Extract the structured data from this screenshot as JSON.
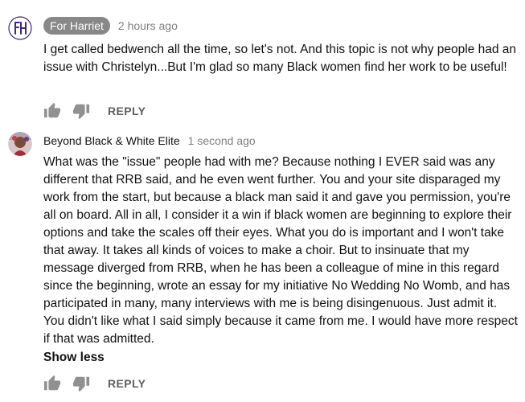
{
  "comments": [
    {
      "author": "For Harriet",
      "author_is_badge": true,
      "timestamp": "2 hours ago",
      "text": "I get called bedwench all the time, so let's not. And this topic is not why people had an issue with Christelyn...But I'm glad so many Black women find her work to be useful!",
      "like_icon": "thumbs-up-icon",
      "dislike_icon": "thumbs-down-icon",
      "reply_label": "REPLY",
      "avatar_icon": "FH monogram"
    },
    {
      "author": "Beyond Black & White Elite",
      "timestamp": "1 second ago",
      "text": "What was the \"issue\" people had with me? Because nothing I EVER said was any different that RRB said, and he even went further. You and your site disparaged my work from the start, but because a black man said it and gave you permission, you're all on board. All in all, I consider it a win if black women are beginning to explore their options and take the scales off their eyes. What you do is important and I won't take that away. It takes all kinds of voices to make a choir. But to insinuate that my message diverged from RRB, when he has been a colleague of mine in this regard since the beginning, wrote an essay for my initiative No Wedding No Womb, and has participated in many, many interviews with me is being disingenuous. Just admit it. You didn't like what I said simply because it came from me. I would have more respect if that was admitted.",
      "show_less_label": "Show less",
      "like_icon": "thumbs-up-icon",
      "dislike_icon": "thumbs-down-icon",
      "reply_label": "REPLY",
      "avatar_icon": "photo avatar"
    }
  ],
  "colors": {
    "badge_bg": "#888888",
    "timestamp": "#808080",
    "icon": "#909090",
    "reply": "#606060",
    "monogram": "#3b2a7a"
  }
}
